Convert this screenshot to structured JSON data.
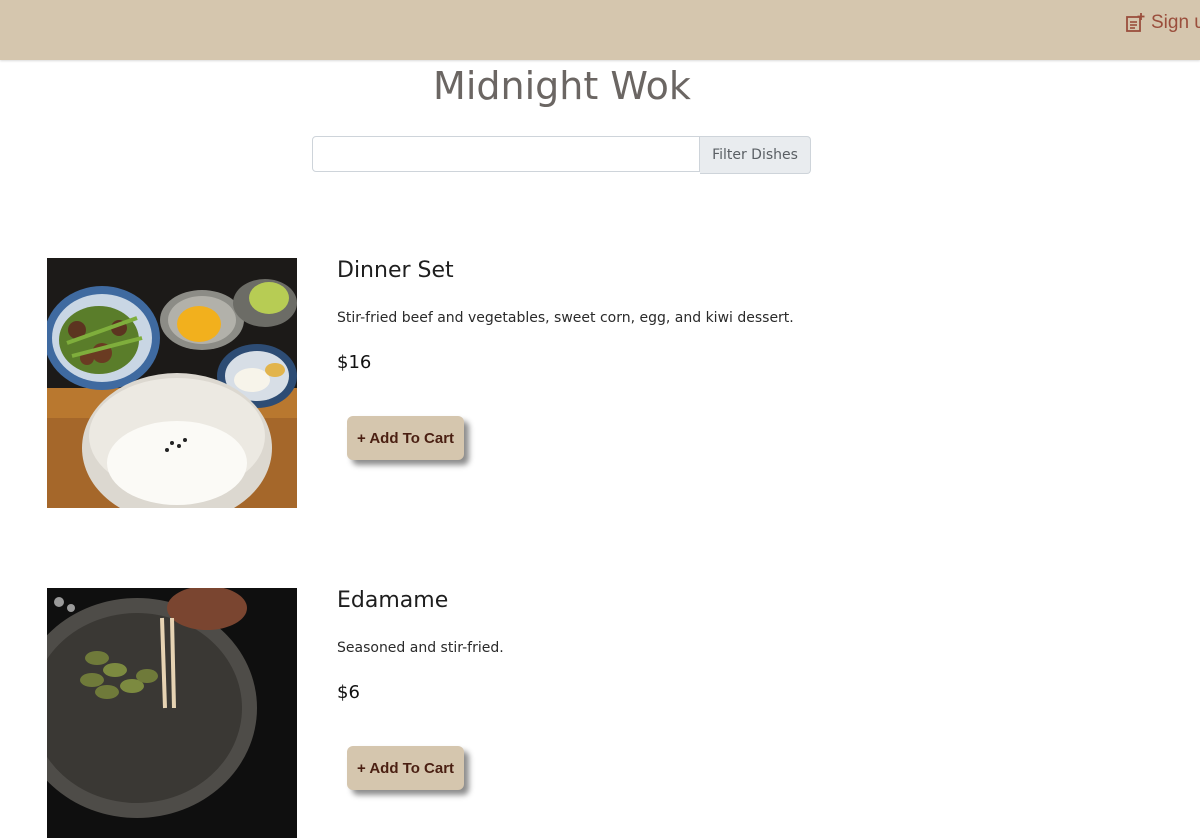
{
  "header": {
    "signup_label": "Sign up",
    "signup_icon": "note-plus-icon",
    "background": "#d5c6ae",
    "accent": "#9a4e3c"
  },
  "page": {
    "title": "Midnight Wok"
  },
  "search": {
    "value": "",
    "placeholder": "",
    "button_label": "Filter Dishes"
  },
  "dishes": [
    {
      "name": "Dinner Set",
      "description": "Stir-fried beef and vegetables, sweet corn, egg, and kiwi dessert.",
      "price": "$16",
      "button_label": "+ Add To Cart"
    },
    {
      "name": "Edamame",
      "description": "Seasoned and stir-fried.",
      "price": "$6",
      "button_label": "+ Add To Cart"
    }
  ]
}
